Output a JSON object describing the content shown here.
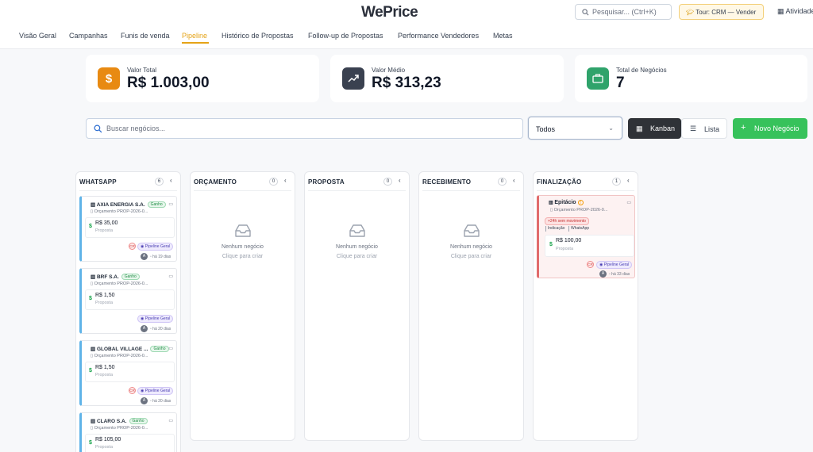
{
  "header": {
    "logo": "WePrice",
    "search_placeholder": "Pesquisar... (Ctrl+K)",
    "tour": "Tour: CRM — Vender",
    "atividades": "Atividades"
  },
  "nav": [
    {
      "label": "Visão Geral",
      "active": false
    },
    {
      "label": "Campanhas",
      "active": false
    },
    {
      "label": "Funis de venda",
      "active": false
    },
    {
      "label": "Pipeline",
      "active": true
    },
    {
      "label": "Histórico de Propostas",
      "active": false
    },
    {
      "label": "Follow-up de Propostas",
      "active": false
    },
    {
      "label": "Performance Vendedores",
      "active": false
    },
    {
      "label": "Metas",
      "active": false
    }
  ],
  "stats": [
    {
      "label": "Valor Total",
      "value": "R$ 1.003,00",
      "color": "#e88a12",
      "icon": "dollar-icon"
    },
    {
      "label": "Valor Médio",
      "value": "R$ 313,23",
      "color": "#3a4150",
      "icon": "trend-up-icon"
    },
    {
      "label": "Total de Negócios",
      "value": "7",
      "color": "#2fa36b",
      "icon": "briefcase-icon"
    }
  ],
  "toolbar": {
    "search_placeholder": "Buscar negócios...",
    "filter_value": "Todos",
    "kanban": "Kanban",
    "lista": "Lista",
    "novo": "Novo Negócio"
  },
  "columns": [
    {
      "title": "WHATSAPP",
      "count": "6",
      "empty_title": "",
      "empty_sub": ""
    },
    {
      "title": "ORÇAMENTO",
      "count": "0",
      "empty_title": "Nenhum negócio",
      "empty_sub": "Clique para criar"
    },
    {
      "title": "PROPOSTA",
      "count": "0",
      "empty_title": "Nenhum negócio",
      "empty_sub": "Clique para criar"
    },
    {
      "title": "RECEBIMENTO",
      "count": "0",
      "empty_title": "Nenhum negócio",
      "empty_sub": "Clique para criar"
    },
    {
      "title": "FINALIZAÇÃO",
      "count": "1",
      "empty_title": "",
      "empty_sub": ""
    }
  ],
  "whatsapp_cards": [
    {
      "name": "AXIA ENERGIA S.A.",
      "badge": "Ganho",
      "orc": "Orçamento PROP-2026-0...",
      "value": "R$ 35,00",
      "stage": "Proposta",
      "pipeline": "Pipeline Geral",
      "avatar": "A",
      "time": "há 19 dias",
      "crm": "CR"
    },
    {
      "name": "BRF S.A.",
      "badge": "Ganho",
      "orc": "Orçamento PROP-2026-0...",
      "value": "R$ 1,50",
      "stage": "Proposta",
      "pipeline": "Pipeline Geral",
      "avatar": "A",
      "time": "há 20 dias",
      "crm": ""
    },
    {
      "name": "GLOBAL VILLAGE ...",
      "badge": "Ganho",
      "orc": "Orçamento PROP-2026-0...",
      "value": "R$ 1,50",
      "stage": "Proposta",
      "pipeline": "Pipeline Geral",
      "avatar": "A",
      "time": "há 20 dias",
      "crm": "CR"
    },
    {
      "name": "CLARO S.A.",
      "badge": "Ganho",
      "orc": "Orçamento PROP-2026-0...",
      "value": "R$ 105,00",
      "stage": "Proposta",
      "pipeline": "",
      "avatar": "",
      "time": "",
      "crm": ""
    }
  ],
  "final_card": {
    "name": "Epitácio",
    "orc": "Orçamento PROP-2026-0...",
    "alert": "+24h sem movimento",
    "tags": [
      "Indicação",
      "WhatsApp"
    ],
    "value": "R$ 100,00",
    "stage": "Proposta",
    "pipeline": "Pipeline Geral",
    "avatar": "A",
    "time": "há 33 dias",
    "crm": "CR"
  }
}
